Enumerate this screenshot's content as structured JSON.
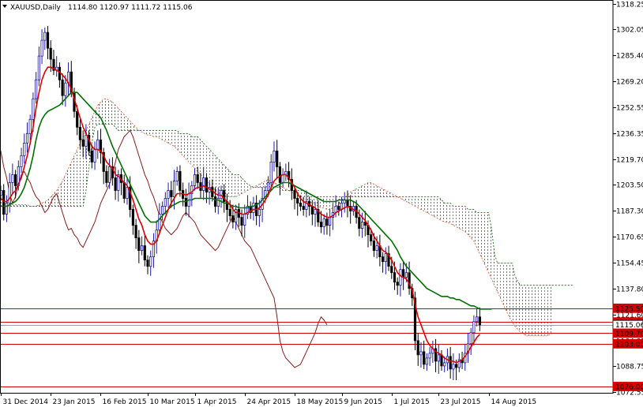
{
  "header": {
    "symbol": "XAUUSD,Daily",
    "ohlc": "1114.80 1120.97 1111.72 1115.06"
  },
  "colors": {
    "bull": "#1a1aaa",
    "bear": "#000000",
    "tenkan": "#e00000",
    "kijun": "#007000",
    "chikou": "#8b1a1a",
    "cloud_bear": "#e05020",
    "cloud_bull": "#2e8b57",
    "hline": "#d00000",
    "label_red": "#d40000"
  },
  "chart_data": {
    "type": "candlestick",
    "y_axis_ticks": [
      "1318.25",
      "1302.05",
      "1285.40",
      "1269.20",
      "1252.55",
      "1236.35",
      "1219.70",
      "1203.50",
      "1187.30",
      "1170.65",
      "1154.45",
      "1137.80",
      "1121.60",
      "1104.95",
      "1088.75",
      "1072.55"
    ],
    "ylim": [
      1072.0,
      1320.5
    ],
    "x_axis_ticks": [
      "31 Dec 2014",
      "23 Jan 2015",
      "16 Feb 2015",
      "10 Mar 2015",
      "1 Apr 2015",
      "24 Apr 2015",
      "18 May 2015",
      "9 Jun 2015",
      "1 Jul 2015",
      "23 Jul 2015",
      "14 Aug 2015"
    ],
    "x_tick_index": [
      0,
      17,
      34,
      50,
      66,
      83,
      100,
      116,
      133,
      149,
      166
    ],
    "price_labels": [
      {
        "text": "1125.50",
        "value": 1125.5,
        "style": "red"
      },
      {
        "text": "1116.80",
        "value": 1116.8,
        "style": "red"
      },
      {
        "text": "1115.06",
        "value": 1115.06,
        "style": "current"
      },
      {
        "text": "1109.70",
        "value": 1109.7,
        "style": "red"
      },
      {
        "text": "1103.00",
        "value": 1103.0,
        "style": "red"
      },
      {
        "text": "1076.00",
        "value": 1076.0,
        "style": "red"
      }
    ],
    "closes": [
      1200,
      1185,
      1192,
      1205,
      1210,
      1203,
      1215,
      1222,
      1230,
      1236,
      1245,
      1258,
      1270,
      1285,
      1295,
      1300,
      1290,
      1283,
      1276,
      1278,
      1270,
      1260,
      1268,
      1275,
      1262,
      1250,
      1240,
      1232,
      1228,
      1235,
      1225,
      1218,
      1226,
      1232,
      1224,
      1212,
      1205,
      1215,
      1208,
      1200,
      1210,
      1205,
      1195,
      1202,
      1188,
      1178,
      1170,
      1162,
      1165,
      1156,
      1152,
      1158,
      1168,
      1175,
      1185,
      1190,
      1195,
      1200,
      1196,
      1206,
      1212,
      1200,
      1195,
      1190,
      1198,
      1203,
      1210,
      1205,
      1200,
      1208,
      1199,
      1202,
      1196,
      1190,
      1195,
      1200,
      1193,
      1188,
      1184,
      1180,
      1188,
      1183,
      1178,
      1185,
      1190,
      1186,
      1192,
      1184,
      1188,
      1195,
      1200,
      1205,
      1218,
      1225,
      1215,
      1205,
      1210,
      1212,
      1207,
      1200,
      1195,
      1192,
      1190,
      1188,
      1193,
      1190,
      1185,
      1188,
      1180,
      1177,
      1182,
      1178,
      1183,
      1186,
      1190,
      1188,
      1192,
      1194,
      1190,
      1187,
      1190,
      1183,
      1176,
      1180,
      1178,
      1172,
      1168,
      1162,
      1165,
      1158,
      1155,
      1160,
      1152,
      1148,
      1142,
      1140,
      1150,
      1145,
      1148,
      1138,
      1132,
      1105,
      1096,
      1098,
      1090,
      1094,
      1097,
      1100,
      1092,
      1096,
      1089,
      1091,
      1095,
      1087,
      1090,
      1088,
      1093,
      1091,
      1097,
      1103,
      1110,
      1117,
      1120,
      1115
    ],
    "tenkan": [
      1195,
      1193,
      1193,
      1195,
      1198,
      1200,
      1204,
      1208,
      1215,
      1222,
      1230,
      1240,
      1252,
      1262,
      1270,
      1275,
      1278,
      1278,
      1277,
      1276,
      1275,
      1273,
      1271,
      1268,
      1264,
      1258,
      1252,
      1246,
      1240,
      1236,
      1232,
      1228,
      1226,
      1226,
      1225,
      1222,
      1218,
      1216,
      1214,
      1210,
      1209,
      1207,
      1205,
      1203,
      1199,
      1194,
      1188,
      1182,
      1178,
      1172,
      1168,
      1166,
      1166,
      1168,
      1173,
      1178,
      1183,
      1188,
      1192,
      1195,
      1198,
      1198,
      1198,
      1197,
      1198,
      1199,
      1201,
      1202,
      1202,
      1203,
      1202,
      1201,
      1200,
      1198,
      1197,
      1197,
      1195,
      1193,
      1191,
      1188,
      1186,
      1186,
      1185,
      1185,
      1186,
      1187,
      1188,
      1188,
      1189,
      1191,
      1194,
      1197,
      1202,
      1206,
      1208,
      1209,
      1210,
      1210,
      1208,
      1205,
      1202,
      1198,
      1195,
      1193,
      1192,
      1191,
      1190,
      1189,
      1187,
      1185,
      1184,
      1183,
      1183,
      1184,
      1186,
      1187,
      1188,
      1189,
      1190,
      1189,
      1188,
      1187,
      1185,
      1183,
      1181,
      1178,
      1175,
      1171,
      1168,
      1165,
      1162,
      1161,
      1159,
      1156,
      1152,
      1148,
      1146,
      1145,
      1144,
      1141,
      1137,
      1128,
      1120,
      1115,
      1110,
      1105,
      1102,
      1100,
      1098,
      1097,
      1096,
      1094,
      1093,
      1092,
      1092,
      1091,
      1092,
      1093,
      1095,
      1098,
      1101,
      1104,
      1107,
      1109
    ],
    "kijun": [
      1190,
      1190,
      1190,
      1191,
      1192,
      1193,
      1195,
      1198,
      1202,
      1208,
      1214,
      1222,
      1232,
      1240,
      1245,
      1248,
      1250,
      1251,
      1252,
      1253,
      1254,
      1256,
      1258,
      1260,
      1262,
      1262,
      1262,
      1260,
      1258,
      1256,
      1254,
      1252,
      1250,
      1248,
      1246,
      1242,
      1238,
      1233,
      1228,
      1224,
      1220,
      1216,
      1212,
      1208,
      1204,
      1200,
      1196,
      1192,
      1188,
      1184,
      1182,
      1180,
      1180,
      1180,
      1182,
      1184,
      1186,
      1188,
      1190,
      1191,
      1192,
      1193,
      1193,
      1193,
      1194,
      1194,
      1195,
      1195,
      1195,
      1195,
      1195,
      1195,
      1195,
      1194,
      1194,
      1193,
      1192,
      1192,
      1191,
      1190,
      1190,
      1189,
      1189,
      1189,
      1189,
      1190,
      1190,
      1191,
      1192,
      1194,
      1196,
      1198,
      1200,
      1202,
      1203,
      1204,
      1205,
      1205,
      1205,
      1204,
      1203,
      1202,
      1201,
      1200,
      1199,
      1198,
      1197,
      1196,
      1195,
      1194,
      1193,
      1193,
      1193,
      1193,
      1193,
      1194,
      1194,
      1194,
      1194,
      1194,
      1193,
      1192,
      1190,
      1188,
      1186,
      1184,
      1182,
      1180,
      1178,
      1176,
      1174,
      1172,
      1170,
      1168,
      1165,
      1162,
      1158,
      1155,
      1152,
      1150,
      1148,
      1146,
      1144,
      1142,
      1140,
      1138,
      1137,
      1136,
      1135,
      1134,
      1133,
      1133,
      1133,
      1132,
      1132,
      1131,
      1131,
      1130,
      1129,
      1128,
      1127,
      1127,
      1126,
      1125,
      1125,
      1125,
      1125,
      1125
    ],
    "chikou": [
      1225,
      1215,
      1208,
      1198,
      1192,
      1196,
      1204,
      1210,
      1212,
      1208,
      1205,
      1200,
      1196,
      1194,
      1190,
      1186,
      1188,
      1192,
      1196,
      1198,
      1192,
      1186,
      1180,
      1175,
      1176,
      1172,
      1170,
      1166,
      1164,
      1168,
      1172,
      1176,
      1180,
      1186,
      1192,
      1196,
      1200,
      1204,
      1210,
      1218,
      1226,
      1230,
      1234,
      1236,
      1238,
      1234,
      1228,
      1222,
      1216,
      1210,
      1206,
      1200,
      1196,
      1190,
      1184,
      1180,
      1176,
      1174,
      1172,
      1174,
      1176,
      1180,
      1184,
      1186,
      1184,
      1182,
      1180,
      1176,
      1172,
      1170,
      1168,
      1166,
      1164,
      1162,
      1164,
      1168,
      1172,
      1176,
      1180,
      1184,
      1180,
      1176,
      1172,
      1168,
      1166,
      1164,
      1160,
      1156,
      1152,
      1148,
      1144,
      1140,
      1136,
      1132,
      1120,
      1105,
      1098,
      1094,
      1092,
      1090,
      1088,
      1089,
      1090,
      1094,
      1098,
      1102,
      1106,
      1110,
      1116,
      1120,
      1118,
      1115
    ],
    "span_a": [
      1195,
      1194,
      1193,
      1192,
      1191,
      1191,
      1191,
      1191,
      1191,
      1191,
      1190,
      1190,
      1190,
      1191,
      1192,
      1193,
      1194,
      1196,
      1198,
      1200,
      1203,
      1206,
      1210,
      1214,
      1218,
      1222,
      1226,
      1230,
      1234,
      1238,
      1242,
      1246,
      1250,
      1254,
      1256,
      1258,
      1258,
      1257,
      1256,
      1254,
      1252,
      1250,
      1248,
      1246,
      1244,
      1242,
      1240,
      1238,
      1237,
      1236,
      1235,
      1235,
      1234,
      1234,
      1233,
      1232,
      1231,
      1230,
      1229,
      1228,
      1226,
      1224,
      1222,
      1220,
      1218,
      1216,
      1214,
      1212,
      1210,
      1208,
      1206,
      1204,
      1202,
      1200,
      1198,
      1197,
      1196,
      1196,
      1196,
      1196,
      1196,
      1197,
      1198,
      1199,
      1200,
      1201,
      1202,
      1203,
      1204,
      1205,
      1206,
      1207,
      1206,
      1205,
      1204,
      1203,
      1202,
      1201,
      1200,
      1199,
      1198,
      1197,
      1196,
      1195,
      1194,
      1193,
      1192,
      1191,
      1190,
      1189,
      1189,
      1188,
      1188,
      1189,
      1190,
      1191,
      1193,
      1195,
      1197,
      1199,
      1200,
      1201,
      1202,
      1203,
      1204,
      1205,
      1205,
      1204,
      1203,
      1202,
      1201,
      1200,
      1199,
      1198,
      1197,
      1196,
      1195,
      1194,
      1193,
      1192,
      1191,
      1190,
      1189,
      1188,
      1187,
      1186,
      1185,
      1184,
      1183,
      1182,
      1181,
      1180,
      1180,
      1179,
      1178,
      1177,
      1176,
      1175,
      1174,
      1172,
      1170,
      1168,
      1164,
      1160,
      1156,
      1152,
      1148,
      1144,
      1140,
      1136,
      1132,
      1128,
      1124,
      1120,
      1117,
      1114,
      1112,
      1110,
      1109,
      1108,
      1108,
      1108,
      1108,
      1108,
      1108,
      1108,
      1108,
      1109,
      1110
    ],
    "span_b": [
      1190,
      1190,
      1190,
      1190,
      1190,
      1190,
      1190,
      1190,
      1190,
      1190,
      1190,
      1190,
      1190,
      1190,
      1190,
      1190,
      1190,
      1190,
      1190,
      1190,
      1190,
      1190,
      1190,
      1190,
      1190,
      1190,
      1190,
      1190,
      1190,
      1200,
      1215,
      1230,
      1240,
      1242,
      1242,
      1242,
      1242,
      1242,
      1242,
      1240,
      1238,
      1238,
      1238,
      1238,
      1238,
      1238,
      1238,
      1238,
      1238,
      1238,
      1238,
      1238,
      1238,
      1238,
      1238,
      1238,
      1238,
      1238,
      1238,
      1238,
      1238,
      1236,
      1236,
      1236,
      1236,
      1234,
      1234,
      1234,
      1232,
      1230,
      1228,
      1226,
      1224,
      1222,
      1220,
      1218,
      1216,
      1214,
      1212,
      1210,
      1210,
      1210,
      1208,
      1206,
      1204,
      1203,
      1202,
      1202,
      1202,
      1202,
      1202,
      1202,
      1202,
      1202,
      1202,
      1202,
      1200,
      1200,
      1200,
      1200,
      1200,
      1200,
      1200,
      1200,
      1198,
      1196,
      1196,
      1196,
      1196,
      1196,
      1196,
      1196,
      1196,
      1196,
      1196,
      1196,
      1196,
      1196,
      1196,
      1196,
      1196,
      1196,
      1196,
      1196,
      1196,
      1196,
      1196,
      1196,
      1196,
      1196,
      1196,
      1196,
      1196,
      1196,
      1196,
      1196,
      1196,
      1196,
      1196,
      1196,
      1196,
      1196,
      1196,
      1196,
      1196,
      1196,
      1196,
      1196,
      1196,
      1196,
      1194,
      1192,
      1192,
      1192,
      1190,
      1190,
      1190,
      1190,
      1190,
      1188,
      1188,
      1188,
      1186,
      1186,
      1186,
      1186,
      1186,
      1176,
      1160,
      1154,
      1154,
      1154,
      1154,
      1154,
      1154,
      1146,
      1142,
      1140,
      1140,
      1140,
      1140,
      1140,
      1140,
      1140,
      1140,
      1140,
      1140,
      1140,
      1140,
      1140,
      1140,
      1140,
      1140,
      1140,
      1140,
      1140
    ]
  }
}
